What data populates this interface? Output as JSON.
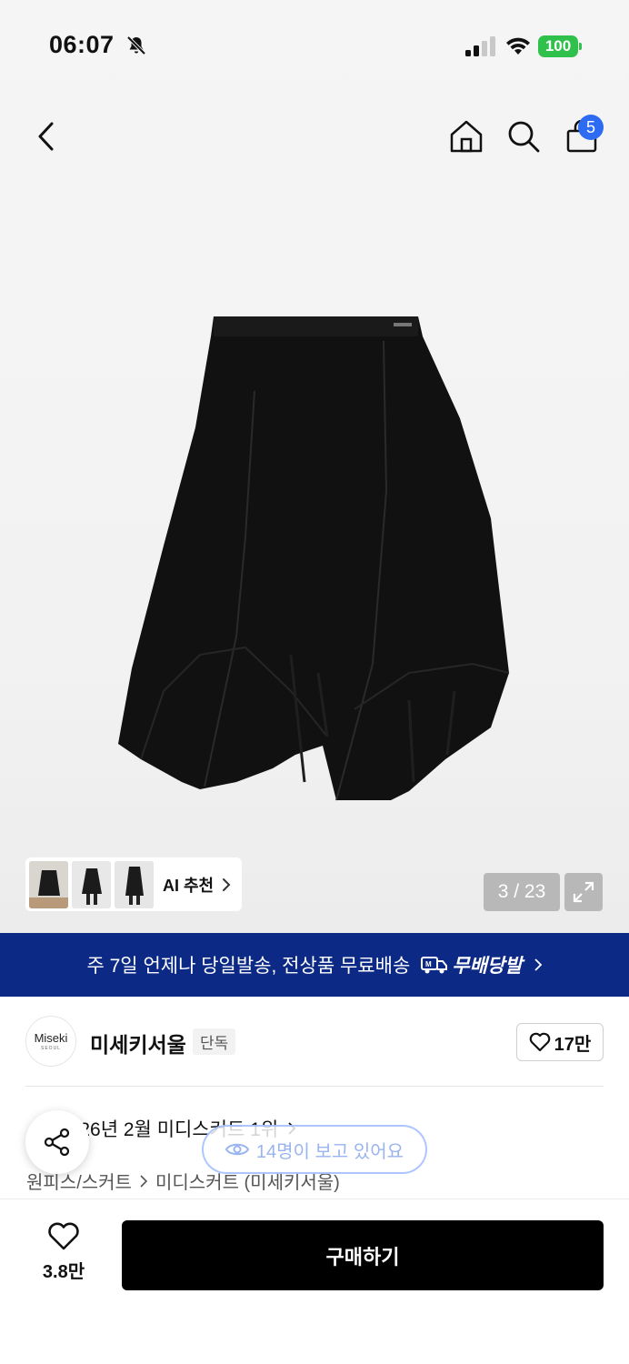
{
  "status_bar": {
    "time": "06:07",
    "battery": "100",
    "icons": [
      "bell-off-icon",
      "signal-icon",
      "wifi-icon",
      "battery-icon"
    ]
  },
  "nav": {
    "icons": [
      "chevron-left-icon",
      "home-icon",
      "search-icon",
      "shopping-bag-icon"
    ],
    "cart_count": "5"
  },
  "gallery": {
    "ai_label": "AI 추천",
    "counter": "3 / 23",
    "thumbnail_count": 3
  },
  "promo": {
    "text": "주 7일 언제나 당일발송, 전상품 무료배송",
    "brand": "무배당발",
    "background": "#0c2a85"
  },
  "brand": {
    "logo_main": "Miseki",
    "logo_sub": "SEOUL",
    "name": "미세키서울",
    "badge": "단독",
    "likes": "17만"
  },
  "ranking": {
    "text": "2026년 2월 미디스커트 1위"
  },
  "breadcrumb": {
    "category": "원피스/스커트",
    "subcategory": "미디스커트 (미세키서울)"
  },
  "viewers": {
    "text": "14명이 보고 있어요"
  },
  "bottom": {
    "wish_count": "3.8만",
    "buy_label": "구매하기"
  },
  "colors": {
    "accent": "#2d6bf3",
    "battery": "#2fc14b",
    "buy_button": "#000000"
  }
}
